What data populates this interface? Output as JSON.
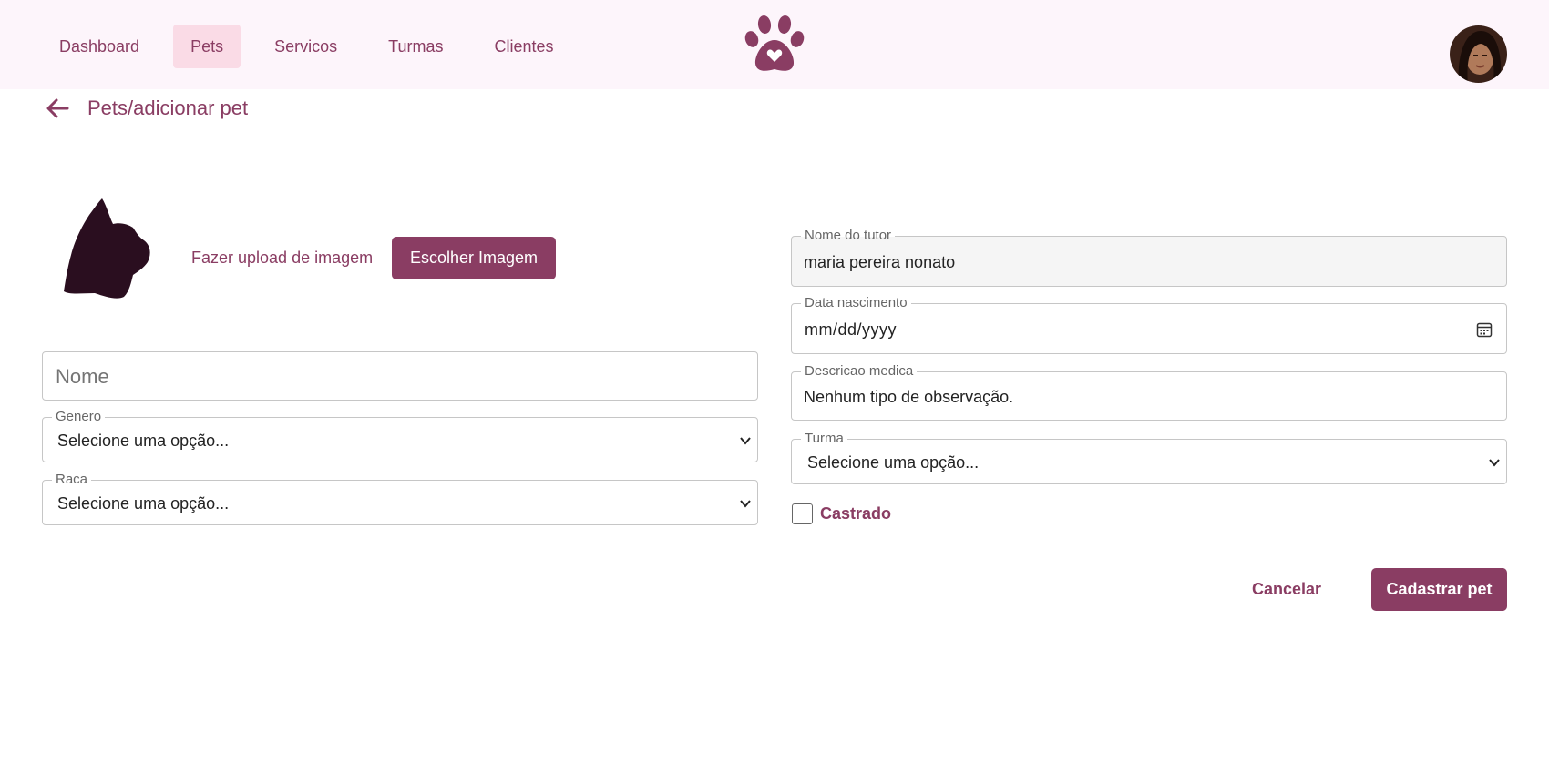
{
  "nav": {
    "items": [
      {
        "label": "Dashboard"
      },
      {
        "label": "Pets"
      },
      {
        "label": "Servicos"
      },
      {
        "label": "Turmas"
      },
      {
        "label": "Clientes"
      }
    ],
    "active": "Pets"
  },
  "breadcrumb": {
    "title": "Pets/adicionar pet"
  },
  "upload": {
    "label": "Fazer upload de imagem",
    "button": "Escolher Imagem"
  },
  "form": {
    "nome": {
      "placeholder": "Nome"
    },
    "genero": {
      "label": "Genero",
      "value": "Selecione uma opção..."
    },
    "raca": {
      "label": "Raca",
      "value": "Selecione uma opção..."
    },
    "tutor": {
      "label": "Nome do tutor",
      "value": "maria pereira nonato"
    },
    "nascimento": {
      "label": "Data nascimento",
      "value": "mm/dd/yyyy"
    },
    "descricao": {
      "label": "Descricao medica",
      "value": "Nenhum tipo de observação."
    },
    "turma": {
      "label": "Turma",
      "value": "Selecione uma opção..."
    },
    "castrado": {
      "label": "Castrado",
      "checked": false
    }
  },
  "actions": {
    "cancel": "Cancelar",
    "submit": "Cadastrar pet"
  },
  "colors": {
    "brand": "#8a3d63",
    "nav_bg": "#fdf5fb",
    "active_tab": "#fadbe6",
    "silhouette": "#2a0e1f"
  }
}
